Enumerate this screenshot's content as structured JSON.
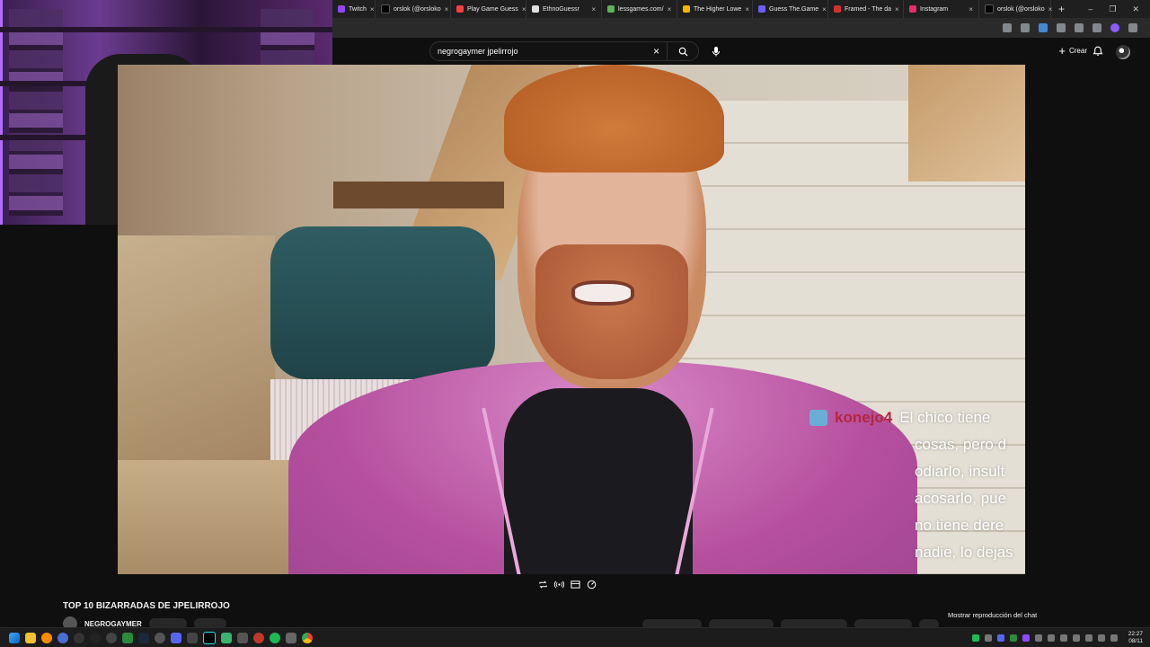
{
  "browser": {
    "tabs": [
      {
        "label": "Twitch",
        "color": "#9146ff"
      },
      {
        "label": "orslok (@orsloko",
        "color": "#000000"
      },
      {
        "label": "Play Game Guess",
        "color": "#ff3d3d"
      },
      {
        "label": "EthnoGuessr",
        "color": "#e0e0e0"
      },
      {
        "label": "lessgames.com/",
        "color": "#5ab552"
      },
      {
        "label": "The Higher Lowe",
        "color": "#f5b400"
      },
      {
        "label": "Guess The.Game",
        "color": "#6f5cff"
      },
      {
        "label": "Framed - The da",
        "color": "#d32f2f"
      },
      {
        "label": "Instagram",
        "color": "#e1306c"
      },
      {
        "label": "orslok (@orsloko",
        "color": "#000000"
      }
    ],
    "new_tab": "+",
    "win_controls": [
      "–",
      "❐",
      "✕"
    ]
  },
  "youtube": {
    "search_value": "negrogaymer jpelirrojo",
    "create_label": "Crear",
    "video_title": "TOP 10 BIZARRADAS DE JPELIRROJO",
    "channel_name": "NEGROGAYMER",
    "chat_replay": "Mostrar reproducción del chat"
  },
  "video_overlay": {
    "user": "konejo4",
    "lines": [
      "El chico tiene",
      "cosas, pero d",
      "odiarlo, insult",
      "acosarlo, pue",
      "no tiene dere",
      "nadie, lo dejas"
    ]
  },
  "taskbar": {
    "time": "22:27",
    "date": "08/11"
  },
  "colors": {
    "bg": "#0f0f0f",
    "overlay_user": "#b2263f",
    "hoodie": "#c062ad"
  }
}
